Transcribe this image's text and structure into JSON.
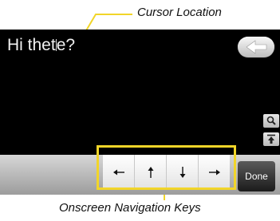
{
  "callouts": {
    "cursor_location": "Cursor Location",
    "onscreen_nav_keys": "Onscreen Navigation Keys"
  },
  "editor": {
    "text_before_cursor": "Hi thet",
    "text_after_cursor": "e?"
  },
  "toolbar": {
    "done_label": "Done"
  },
  "icons": {
    "back": "back-arrow-icon",
    "zoom": "magnifier-icon",
    "top": "jump-to-top-icon",
    "nav": [
      "arrow-left-icon",
      "arrow-up-icon",
      "arrow-down-icon",
      "arrow-right-icon"
    ]
  },
  "colors": {
    "callout": "#f1d529",
    "screen": "#000000",
    "done_bg": "#2c2c2c"
  }
}
